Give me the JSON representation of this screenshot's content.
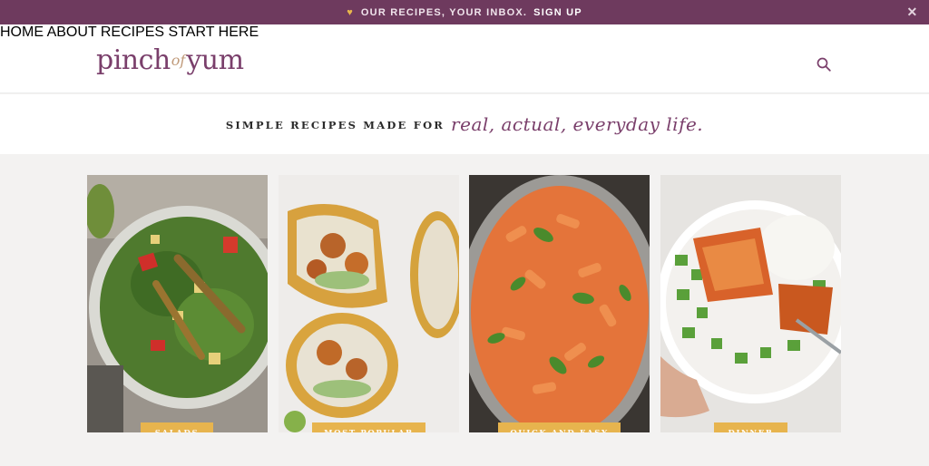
{
  "promo": {
    "text": "OUR RECIPES, YOUR INBOX.",
    "cta": "SIGN UP",
    "heart_icon": "heart-icon",
    "close_icon": "close-icon",
    "colors": {
      "background": "#6e3a5e",
      "heart": "#e8b64c"
    }
  },
  "header": {
    "logo": {
      "part1": "pinch",
      "part2": "of",
      "part3": "yum"
    },
    "nav": [
      "HOME",
      "ABOUT",
      "RECIPES",
      "START HERE"
    ],
    "search_icon": "search-icon"
  },
  "tagline": {
    "caps": "SIMPLE RECIPES MADE FOR",
    "script": "real, actual, everyday life."
  },
  "categories": [
    {
      "label": "SALADS"
    },
    {
      "label": "MOST POPULAR"
    },
    {
      "label": "QUICK AND EASY"
    },
    {
      "label": "DINNER"
    }
  ],
  "colors": {
    "brand": "#7a3f6b",
    "accent": "#e7b44e"
  }
}
